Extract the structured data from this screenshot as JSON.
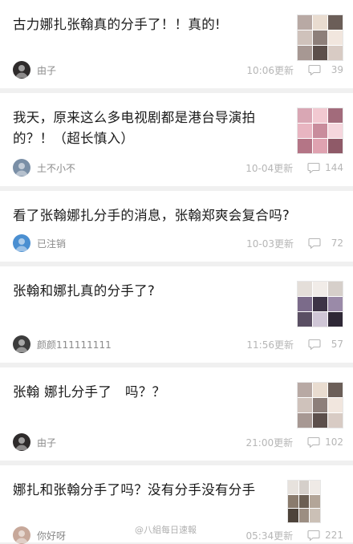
{
  "posts": [
    {
      "title": "古力娜扎张翰真的分手了！！真的!",
      "author": "由子",
      "time": "10:06更新",
      "comments": "39",
      "avatar_color": "#2e2b2b",
      "thumb_colors": [
        "#b8a9a4",
        "#e9dcd0",
        "#6b5e58",
        "#cfc2bb",
        "#8d7f7a",
        "#f1e6de",
        "#a79893",
        "#5c4f4b",
        "#d8cbc4"
      ]
    },
    {
      "title": "我天，原来这么多电视剧都是港台导演拍的？！（超长慎入）",
      "author": "土不小不",
      "time": "10-04更新",
      "comments": "144",
      "avatar_color": "#7a8fa6",
      "thumb_colors": [
        "#d9a7b4",
        "#f2c9d1",
        "#a26b7b",
        "#e8b5c1",
        "#c98c9c",
        "#f5d6dd",
        "#b47586",
        "#dfa2b0",
        "#8f5a68"
      ]
    },
    {
      "title": "看了张翰娜扎分手的消息，张翰郑爽会复合吗?",
      "author": "已注销",
      "time": "10-03更新",
      "comments": "72",
      "avatar_color": "#4a8fd1"
    },
    {
      "title": "张翰和娜扎真的分手了?",
      "author": "颜颜111111111",
      "time": "11:56更新",
      "comments": "57",
      "avatar_color": "#3c3c3c",
      "thumb_colors": [
        "#e4ded9",
        "#f1ece8",
        "#d6cfca",
        "#7b6b8a",
        "#3d3446",
        "#9a8aa8",
        "#5a4f63",
        "#cfc6d6",
        "#2f2836"
      ]
    },
    {
      "title": "张翰 娜扎分手了　吗？？",
      "author": "由子",
      "time": "21:00更新",
      "comments": "102",
      "avatar_color": "#2e2b2b",
      "thumb_colors": [
        "#b8a9a4",
        "#e9dcd0",
        "#6b5e58",
        "#cfc2bb",
        "#8d7f7a",
        "#f1e6de",
        "#a79893",
        "#5c4f4b",
        "#d8cbc4"
      ]
    },
    {
      "title": "娜扎和张翰分手了吗？没有分手没有分手",
      "author": "你好呀",
      "time": "05:34更新",
      "comments": "221",
      "avatar_color": "#c7a89a",
      "thumb_colors": [
        "#e7e2dd",
        "#d5cfca",
        "#efeae6",
        "#8a7b6d",
        "#6c5f53",
        "#b3a598",
        "#4d433a",
        "#9c8e82",
        "#cbc0b6"
      ]
    }
  ],
  "watermark": "@八組每日速報",
  "colors": {
    "background": "#f0f0f0",
    "card": "#ffffff",
    "title_text": "#1a1a1a",
    "meta_text": "#b6b6b6"
  },
  "icons": {
    "comment": "speech-bubble-icon",
    "avatar": "user-avatar"
  }
}
